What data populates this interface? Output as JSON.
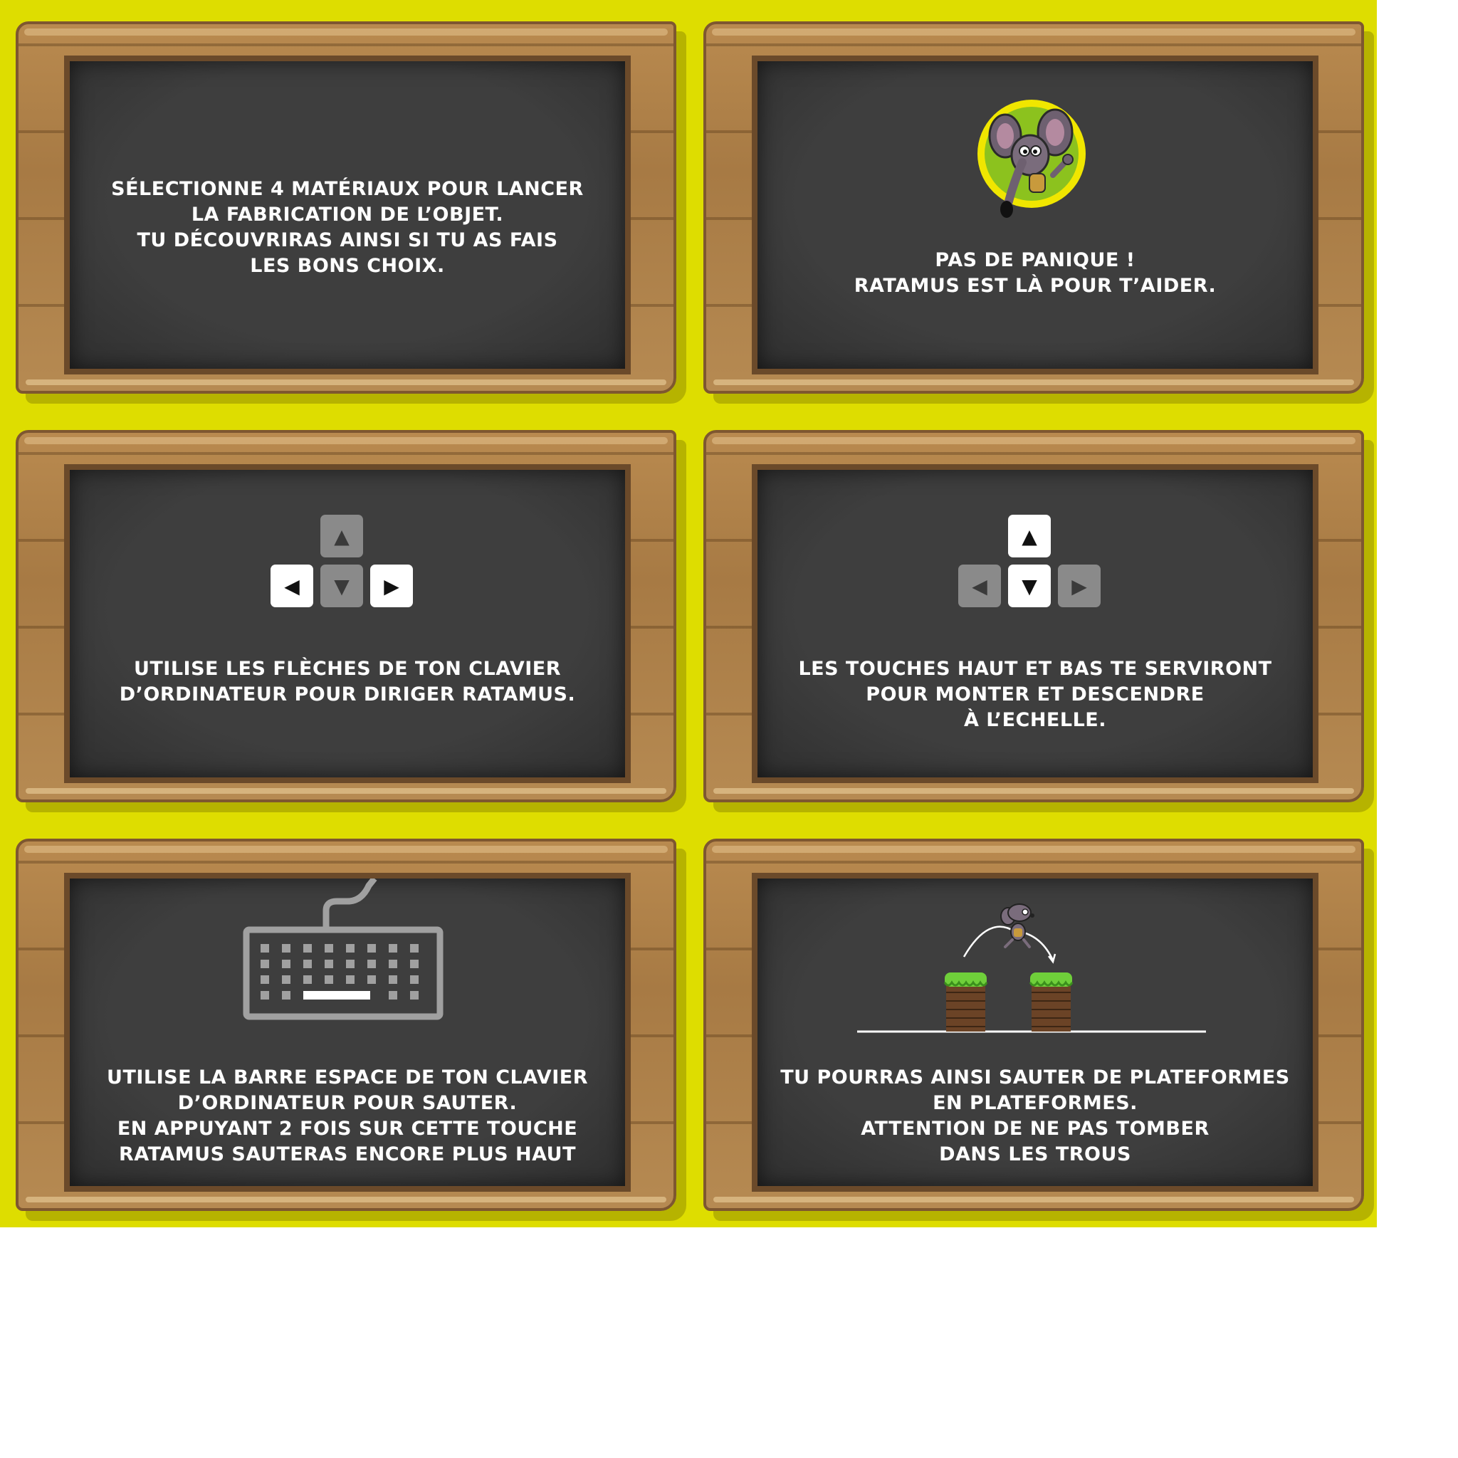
{
  "colors": {
    "background": "#dedd00",
    "wood": "#a77a44",
    "chalkboard": "#3a3a3a",
    "text": "#ffffff",
    "key_active": "#ffffff",
    "key_inactive": "#8a8a8a"
  },
  "panels": [
    {
      "lines": [
        "Sélectionne 4 matériaux pour lancer",
        "la fabrication de l’objet.",
        "Tu découvriras ainsi si tu as fais",
        "les bons choix."
      ]
    },
    {
      "icon": "ratamus-mascot-icon",
      "lines": [
        "Pas de panique !",
        "Ratamus est là pour t’aider."
      ]
    },
    {
      "icon": "arrow-keys-icon",
      "highlighted_keys": [
        "left",
        "right"
      ],
      "keys": {
        "up": "▲",
        "left": "◀",
        "down": "▼",
        "right": "▶"
      },
      "lines": [
        "Utilise les flèches de ton clavier",
        "d’ordinateur pour diriger Ratamus."
      ]
    },
    {
      "icon": "arrow-keys-icon",
      "highlighted_keys": [
        "up",
        "down"
      ],
      "keys": {
        "up": "▲",
        "left": "◀",
        "down": "▼",
        "right": "▶"
      },
      "lines": [
        "Les touches haut et bas te serviront",
        "pour monter et descendre",
        "à l’echelle."
      ]
    },
    {
      "icon": "keyboard-icon",
      "lines": [
        "Utilise la barre espace de ton clavier",
        "d’ordinateur pour sauter.",
        "En appuyant 2 fois sur cette touche",
        "Ratamus sauteras encore plus haut"
      ]
    },
    {
      "icon": "platform-jump-icon",
      "lines": [
        "Tu pourras ainsi sauter de plateformes",
        "en plateformes.",
        "Attention de ne pas tomber",
        "dans les trous"
      ]
    }
  ]
}
